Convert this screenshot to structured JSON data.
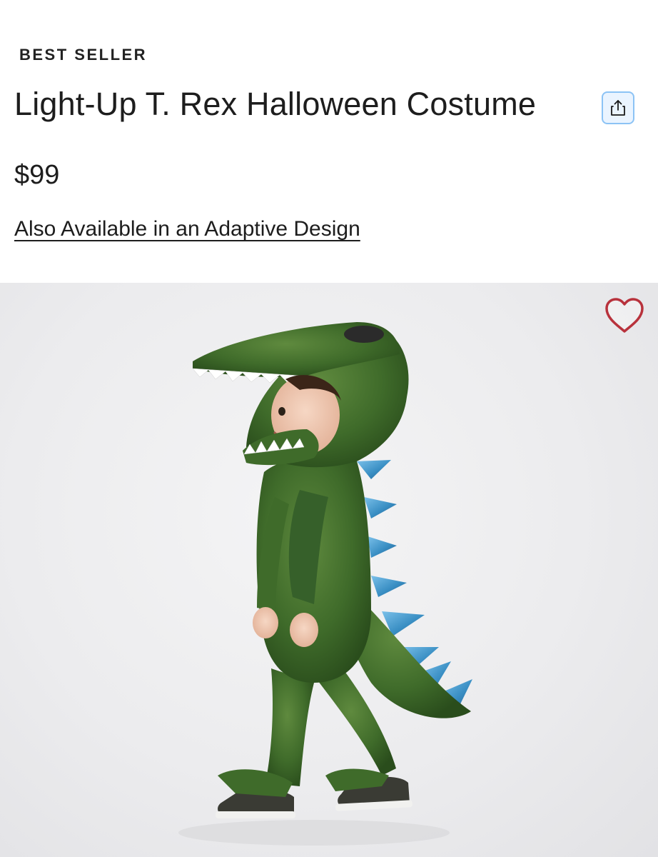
{
  "product": {
    "badge": "BEST SELLER",
    "title": "Light-Up T. Rex Halloween Costume",
    "price": "$99",
    "adaptive_link": "Also Available in an Adaptive Design"
  },
  "icons": {
    "share": "share-icon",
    "favorite": "heart-icon"
  },
  "colors": {
    "share_border": "#8cc3f5",
    "heart": "#b8323c",
    "costume_green": "#3f6b2a",
    "spikes_blue": "#3a8fc4"
  }
}
